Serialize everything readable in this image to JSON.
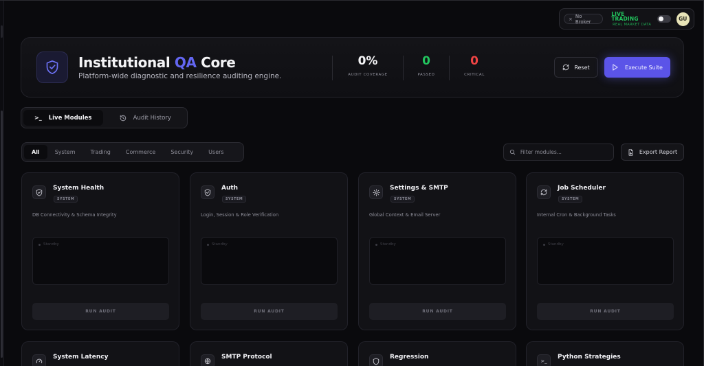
{
  "topbar": {
    "broker_label": "No Broker",
    "trading_mode": "LIVE TRADING",
    "trading_sub": "REAL MARKET DATA",
    "trading_color": "#22c55e",
    "avatar_initials": "GU"
  },
  "header": {
    "title_prefix": "Institutional ",
    "title_accent": "QA",
    "title_suffix": " Core",
    "subtitle": "Platform-wide diagnostic and resilience auditing engine.",
    "accent_color": "#6366f1",
    "stats": [
      {
        "value": "0%",
        "label": "AUDIT COVERAGE",
        "color": "#f4f4f6"
      },
      {
        "value": "0",
        "label": "PASSED",
        "color": "#22c55e"
      },
      {
        "value": "0",
        "label": "CRITICAL",
        "color": "#ef4444"
      }
    ],
    "reset_label": "Reset",
    "execute_label": "Execute Suite"
  },
  "mode_tabs": [
    {
      "label": "Live Modules",
      "icon": "terminal-icon",
      "active": true
    },
    {
      "label": "Audit History",
      "icon": "history-icon",
      "active": false
    }
  ],
  "filters": [
    {
      "label": "All",
      "active": true
    },
    {
      "label": "System",
      "active": false
    },
    {
      "label": "Trading",
      "active": false
    },
    {
      "label": "Commerce",
      "active": false
    },
    {
      "label": "Security",
      "active": false
    },
    {
      "label": "Users",
      "active": false
    }
  ],
  "search": {
    "placeholder": "Filter modules..."
  },
  "export_label": "Export Report",
  "modules": [
    {
      "name": "System Health",
      "category": "SYSTEM",
      "description": "DB Connectivity & Schema Integrity",
      "icon": "shield-check-icon",
      "status": "Standby",
      "action": "RUN AUDIT"
    },
    {
      "name": "Auth",
      "category": "SYSTEM",
      "description": "Login, Session & Role Verification",
      "icon": "shield-check-icon",
      "status": "Standby",
      "action": "RUN AUDIT"
    },
    {
      "name": "Settings & SMTP",
      "category": "SYSTEM",
      "description": "Global Context & Email Server",
      "icon": "gear-icon",
      "status": "Standby",
      "action": "RUN AUDIT"
    },
    {
      "name": "Job Scheduler",
      "category": "SYSTEM",
      "description": "Internal Cron & Background Tasks",
      "icon": "refresh-icon",
      "status": "Standby",
      "action": "RUN AUDIT"
    }
  ],
  "modules_row2": [
    {
      "name": "System Latency",
      "icon": "gauge-icon"
    },
    {
      "name": "SMTP Protocol",
      "icon": "globe-icon"
    },
    {
      "name": "Regression",
      "icon": "shield-icon"
    },
    {
      "name": "Python Strategies",
      "icon": "terminal-icon"
    }
  ]
}
